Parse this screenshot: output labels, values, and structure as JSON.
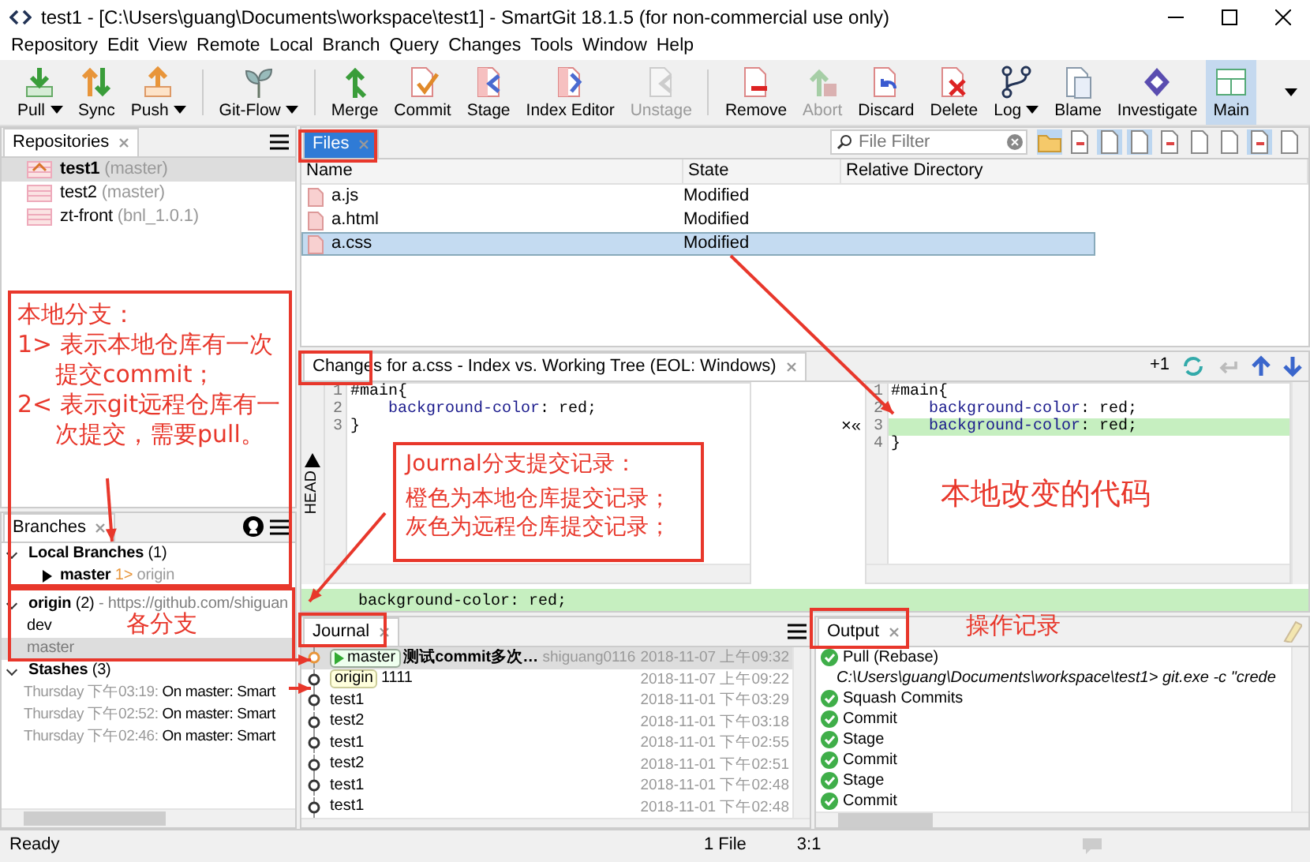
{
  "window": {
    "title": "test1 - [C:\\Users\\guang\\Documents\\workspace\\test1] - SmartGit 18.1.5 (for non-commercial use only)"
  },
  "menu": [
    "Repository",
    "Edit",
    "View",
    "Remote",
    "Local",
    "Branch",
    "Query",
    "Changes",
    "Tools",
    "Window",
    "Help"
  ],
  "toolbar": [
    {
      "label": "Pull",
      "dropdown": true,
      "disabled": false,
      "selected": false,
      "separator_before": false
    },
    {
      "label": "Sync",
      "dropdown": false,
      "disabled": false,
      "selected": false,
      "separator_before": false
    },
    {
      "label": "Push",
      "dropdown": true,
      "disabled": false,
      "selected": false,
      "separator_before": false
    },
    {
      "label": "Git-Flow",
      "dropdown": true,
      "disabled": false,
      "selected": false,
      "separator_before": true
    },
    {
      "label": "Merge",
      "dropdown": false,
      "disabled": false,
      "selected": false,
      "separator_before": true
    },
    {
      "label": "Commit",
      "dropdown": false,
      "disabled": false,
      "selected": false,
      "separator_before": false
    },
    {
      "label": "Stage",
      "dropdown": false,
      "disabled": false,
      "selected": false,
      "separator_before": false
    },
    {
      "label": "Index Editor",
      "dropdown": false,
      "disabled": false,
      "selected": false,
      "separator_before": false
    },
    {
      "label": "Unstage",
      "dropdown": false,
      "disabled": true,
      "selected": false,
      "separator_before": false
    },
    {
      "label": "Remove",
      "dropdown": false,
      "disabled": false,
      "selected": false,
      "separator_before": true
    },
    {
      "label": "Abort",
      "dropdown": false,
      "disabled": true,
      "selected": false,
      "separator_before": false
    },
    {
      "label": "Discard",
      "dropdown": false,
      "disabled": false,
      "selected": false,
      "separator_before": false
    },
    {
      "label": "Delete",
      "dropdown": false,
      "disabled": false,
      "selected": false,
      "separator_before": false
    },
    {
      "label": "Log",
      "dropdown": true,
      "disabled": false,
      "selected": false,
      "separator_before": false
    },
    {
      "label": "Blame",
      "dropdown": false,
      "disabled": false,
      "selected": false,
      "separator_before": false
    },
    {
      "label": "Investigate",
      "dropdown": false,
      "disabled": false,
      "selected": false,
      "separator_before": false
    },
    {
      "label": "Main",
      "dropdown": false,
      "disabled": false,
      "selected": true,
      "separator_before": false
    }
  ],
  "repositories": {
    "tab": "Repositories",
    "items": [
      {
        "name": "test1",
        "branch": "(master)",
        "selected": true
      },
      {
        "name": "test2",
        "branch": "(master)",
        "selected": false
      },
      {
        "name": "zt-front",
        "branch": "(bnl_1.0.1)",
        "selected": false
      }
    ]
  },
  "branches": {
    "tab": "Branches",
    "tree": [
      {
        "label": "Local Branches",
        "count": "(1)",
        "expanded": true,
        "children": [
          {
            "label": "master",
            "ahead": "1>",
            "remote": "origin",
            "selected": false
          }
        ]
      },
      {
        "label": "origin",
        "count": "(2)",
        "url": "- https://github.com/shiguan",
        "expanded": true,
        "children": [
          {
            "label": "dev",
            "selected": false
          },
          {
            "label": "master",
            "selected": true
          }
        ]
      },
      {
        "label": "Stashes",
        "count": "(3)",
        "expanded": true,
        "children": [
          {
            "time": "Thursday 下午03:19:",
            "label": "On master: Smart",
            "selected": false
          },
          {
            "time": "Thursday 下午02:52:",
            "label": "On master: Smart",
            "selected": false
          },
          {
            "time": "Thursday 下午02:46:",
            "label": "On master: Smart",
            "selected": false
          }
        ]
      }
    ]
  },
  "files": {
    "tab": "Files",
    "filter_placeholder": "File Filter",
    "tools": [
      {
        "selected": true
      },
      {
        "selected": false
      },
      {
        "selected": true
      },
      {
        "selected": true
      },
      {
        "selected": false
      },
      {
        "selected": false
      },
      {
        "selected": false
      },
      {
        "selected": true
      },
      {
        "selected": false
      }
    ],
    "columns": [
      "Name",
      "State",
      "Relative Directory"
    ],
    "rows": [
      {
        "name": "a.js",
        "state": "Modified",
        "selected": false
      },
      {
        "name": "a.html",
        "state": "Modified",
        "selected": false
      },
      {
        "name": "a.css",
        "state": "Modified",
        "selected": true
      }
    ]
  },
  "changes": {
    "tab": "Changes for a.css - Index vs. Working Tree (EOL: Windows)",
    "change_count": "+1",
    "side_label": "HEAD",
    "merge_controls": "×«",
    "left": [
      {
        "n": "1",
        "code": "#main{",
        "added": false
      },
      {
        "n": "2",
        "property": "background-color",
        "rest": ": red;",
        "added": false
      },
      {
        "n": "3",
        "code": "}",
        "added": false
      }
    ],
    "right": [
      {
        "n": "1",
        "code": "#main{",
        "added": false
      },
      {
        "n": "2",
        "property": "background-color",
        "rest": ": red;",
        "added": false
      },
      {
        "n": "3",
        "property": "background-color",
        "rest": ": red;",
        "added": true
      },
      {
        "n": "4",
        "code": "}",
        "added": false
      }
    ],
    "preview": "background-color: red;"
  },
  "journal": {
    "tab": "Journal",
    "rows": [
      {
        "refs": [
          {
            "name": "master",
            "kind": "local"
          }
        ],
        "message": "测试commit多次…",
        "author": "shiguang0116",
        "date": "2018-11-07 上午09:32",
        "selected": true,
        "local": true
      },
      {
        "refs": [
          {
            "name": "origin",
            "kind": "remote"
          }
        ],
        "message": "1111",
        "date": "2018-11-07 上午09:22",
        "selected": false,
        "local": false
      },
      {
        "refs": [],
        "message": "test1",
        "date": "2018-11-01 下午03:29",
        "selected": false,
        "local": false
      },
      {
        "refs": [],
        "message": "test2",
        "date": "2018-11-01 下午03:18",
        "selected": false,
        "local": false
      },
      {
        "refs": [],
        "message": "test1",
        "date": "2018-11-01 下午02:55",
        "selected": false,
        "local": false
      },
      {
        "refs": [],
        "message": "test2",
        "date": "2018-11-01 下午02:51",
        "selected": false,
        "local": false
      },
      {
        "refs": [],
        "message": "test1",
        "date": "2018-11-01 下午02:48",
        "selected": false,
        "local": false
      },
      {
        "refs": [],
        "message": "test1",
        "date": "2018-11-01 下午02:48",
        "selected": false,
        "local": false
      }
    ]
  },
  "output": {
    "tab": "Output",
    "items": [
      {
        "kind": "success",
        "text": "Pull (Rebase)"
      },
      {
        "kind": "command",
        "text": "C:\\Users\\guang\\Documents\\workspace\\test1> git.exe -c \"crede"
      },
      {
        "kind": "success",
        "text": "Squash Commits"
      },
      {
        "kind": "success",
        "text": "Commit"
      },
      {
        "kind": "success",
        "text": "Stage"
      },
      {
        "kind": "success",
        "text": "Commit"
      },
      {
        "kind": "success",
        "text": "Stage"
      },
      {
        "kind": "success",
        "text": "Commit"
      }
    ]
  },
  "status_bar": {
    "message": "Ready",
    "files": "1 File",
    "position": "3:1"
  },
  "annotations": {
    "branch_note": [
      "本地分支：",
      "1> 表示本地仓库有一次提交commit；",
      "2< 表示git远程仓库有一次提交，需要pull。"
    ],
    "branches_label": "各分支",
    "journal_note": [
      "Journal分支提交记录：",
      "橙色为本地仓库提交记录；",
      "灰色为远程仓库提交记录；"
    ],
    "changes_label": "本地改变的代码",
    "output_label": "操作记录"
  }
}
